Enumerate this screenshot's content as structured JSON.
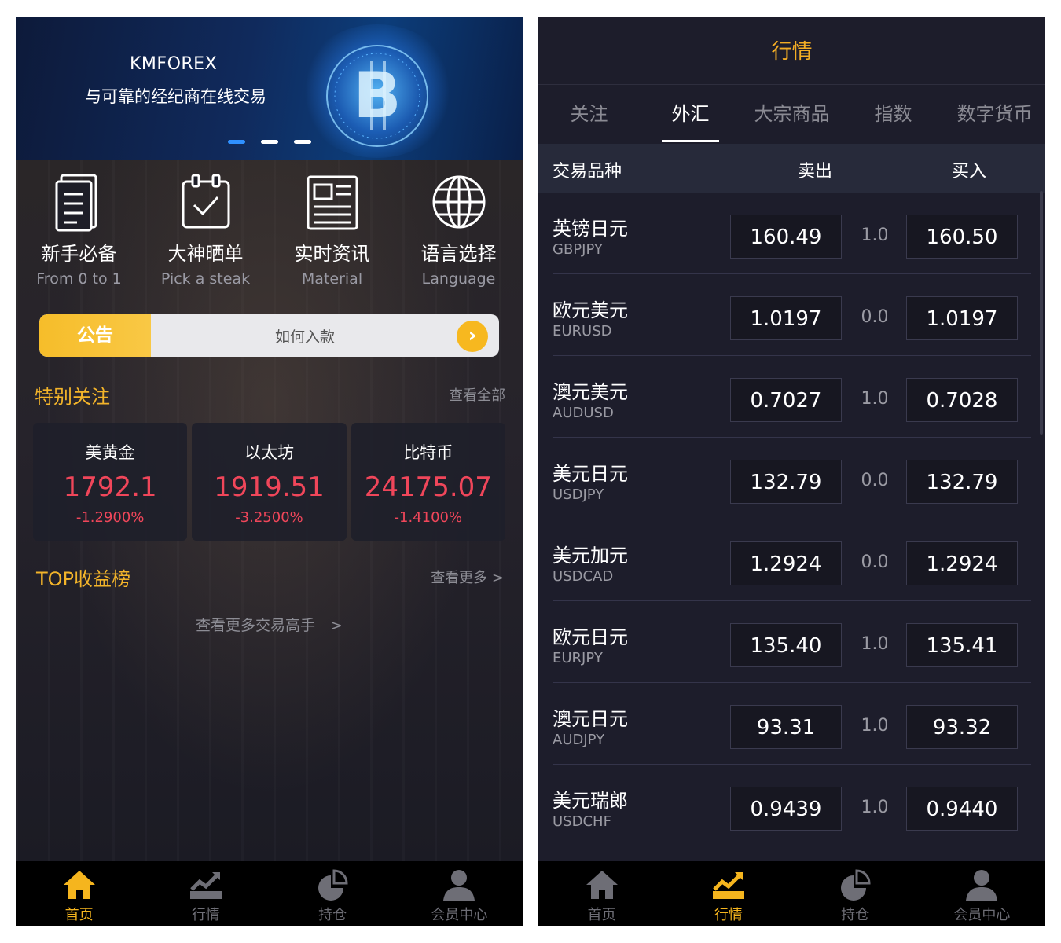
{
  "left": {
    "banner": {
      "brand": "KMFOREX",
      "tagline": "与可靠的经纪商在线交易"
    },
    "features": [
      {
        "title": "新手必备",
        "subtitle": "From 0 to 1",
        "icon": "document-icon"
      },
      {
        "title": "大神晒单",
        "subtitle": "Pick a steak",
        "icon": "calendar-check-icon"
      },
      {
        "title": "实时资讯",
        "subtitle": "Material",
        "icon": "newspaper-icon"
      },
      {
        "title": "语言选择",
        "subtitle": "Language",
        "icon": "globe-icon"
      }
    ],
    "notice": {
      "tag": "公告",
      "text": "如何入款",
      "arrow": "›"
    },
    "special": {
      "title": "特别关注",
      "more": "查看全部"
    },
    "cards": [
      {
        "name": "美黄金",
        "price": "1792.1",
        "change": "-1.2900%"
      },
      {
        "name": "以太坊",
        "price": "1919.51",
        "change": "-3.2500%"
      },
      {
        "name": "比特币",
        "price": "24175.07",
        "change": "-1.4100%"
      }
    ],
    "top": {
      "title": "TOP收益榜",
      "more": "查看更多 >",
      "traders_link": "查看更多交易高手　>"
    },
    "tabbar": {
      "active": 0
    }
  },
  "right": {
    "header": {
      "title": "行情"
    },
    "categories": [
      "关注",
      "外汇",
      "大宗商品",
      "指数",
      "数字货币"
    ],
    "active_category": 1,
    "columns": {
      "symbol": "交易品种",
      "sell": "卖出",
      "buy": "买入"
    },
    "rows": [
      {
        "name": "英镑日元",
        "code": "GBPJPY",
        "sell": "160.49",
        "spread": "1.0",
        "buy": "160.50"
      },
      {
        "name": "欧元美元",
        "code": "EURUSD",
        "sell": "1.0197",
        "spread": "0.0",
        "buy": "1.0197"
      },
      {
        "name": "澳元美元",
        "code": "AUDUSD",
        "sell": "0.7027",
        "spread": "1.0",
        "buy": "0.7028"
      },
      {
        "name": "美元日元",
        "code": "USDJPY",
        "sell": "132.79",
        "spread": "0.0",
        "buy": "132.79"
      },
      {
        "name": "美元加元",
        "code": "USDCAD",
        "sell": "1.2924",
        "spread": "0.0",
        "buy": "1.2924"
      },
      {
        "name": "欧元日元",
        "code": "EURJPY",
        "sell": "135.40",
        "spread": "1.0",
        "buy": "135.41"
      },
      {
        "name": "澳元日元",
        "code": "AUDJPY",
        "sell": "93.31",
        "spread": "1.0",
        "buy": "93.32"
      },
      {
        "name": "美元瑞郎",
        "code": "USDCHF",
        "sell": "0.9439",
        "spread": "1.0",
        "buy": "0.9440"
      }
    ],
    "tabbar": {
      "active": 1
    }
  },
  "tabbar_labels": [
    "首页",
    "行情",
    "持仓",
    "会员中心"
  ],
  "tabbar_icons": [
    "home-icon",
    "chart-trend-icon",
    "pie-chart-icon",
    "user-icon"
  ],
  "colors": {
    "accent": "#f5b51e",
    "down": "#f0465a",
    "bg": "#1d1d2b"
  }
}
